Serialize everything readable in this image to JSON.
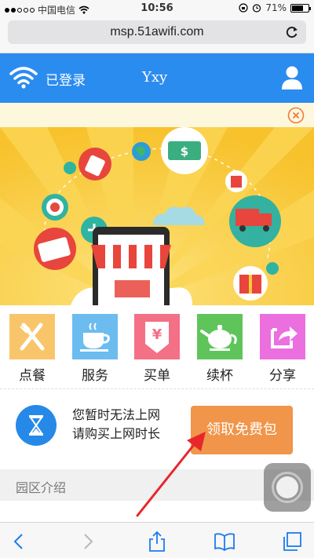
{
  "status_bar": {
    "carrier": "中国电信",
    "time": "10:56",
    "battery_text": "71%",
    "battery_level": 0.71
  },
  "browser": {
    "url": "msp.51awifi.com"
  },
  "header": {
    "status_label": "已登录",
    "username": "Yxy"
  },
  "services": [
    {
      "label": "点餐",
      "icon": "cutlery-icon",
      "color": "#f9c56b"
    },
    {
      "label": "服务",
      "icon": "coffee-cup-icon",
      "color": "#6cbcf0"
    },
    {
      "label": "买单",
      "icon": "yen-tag-icon",
      "color": "#f37087"
    },
    {
      "label": "续杯",
      "icon": "teapot-icon",
      "color": "#5fc55b"
    },
    {
      "label": "分享",
      "icon": "share-icon",
      "color": "#ec6fe0"
    }
  ],
  "promo": {
    "line1": "您暂时无法上网",
    "line2": "请购买上网时长",
    "button_label": "领取免费包"
  },
  "section": {
    "title": "园区介绍"
  },
  "colors": {
    "header_blue": "#2b8cef",
    "cta_orange": "#f0954a",
    "banner_yellow": "#f9cc34"
  }
}
